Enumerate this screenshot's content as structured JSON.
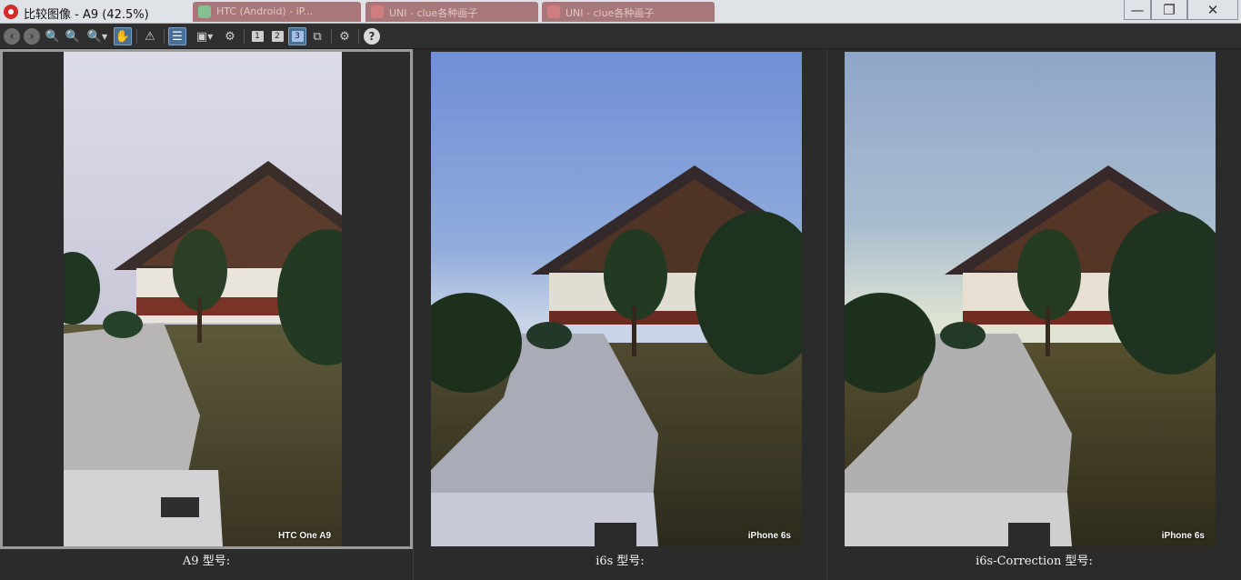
{
  "window": {
    "title": "比较图像 - A9 (42.5%)",
    "background_tabs": [
      "HTC (Android) - iP...",
      "UNI - clue各种画子",
      "UNI - clue各种画子"
    ],
    "buttons": {
      "minimize": "—",
      "restore": "❐",
      "close": "✕"
    }
  },
  "toolbar": {
    "zoom_label": "1",
    "view_labels": [
      "1",
      "2",
      "3"
    ],
    "help": "?"
  },
  "panels": [
    {
      "caption": "A9  型号:",
      "watermark": "HTC One A9",
      "selected": true
    },
    {
      "caption": "i6s  型号:",
      "watermark": "iPhone 6s",
      "selected": false
    },
    {
      "caption": "i6s-Correction  型号:",
      "watermark": "iPhone 6s",
      "selected": false
    }
  ],
  "colors": {
    "accent": "#4b6f93",
    "sky_a9_top": "#d7d7e6",
    "sky_i6s_top": "#6f8fd6",
    "sky_corr_top": "#8fa6c8"
  }
}
